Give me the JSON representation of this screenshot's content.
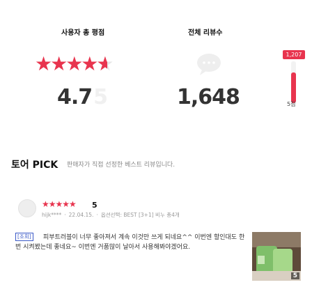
{
  "summary": {
    "rating_title": "사용자 총 평점",
    "reviews_title": "전체 리뷰수",
    "rating_value": "4.7",
    "rating_max": "5",
    "review_count": "1,648",
    "stars_filled": 4.7,
    "bar": {
      "badge": "1,207",
      "label": "5점",
      "fill_fraction": 0.73
    }
  },
  "pick": {
    "title": "토어 PICK",
    "subtitle": "판매자가 직접 선정한 베스트 리뷰입니다."
  },
  "review": {
    "stars": "★★★★★",
    "score": "5",
    "user": "hijk****",
    "date": "22.04.15.",
    "option": "옵션선택: BEST [3+1] 비누 총4개",
    "tag": "[조회]",
    "text": "피부트러블이 너무 좋아져서 계속 이것만 쓰게 되네요^^ 이번엔 할인대도 한번 시켜봤는데 좋네요~ 이번엔 거품많이 날아서 사용해봐야겠어요.",
    "photo_count": "5"
  },
  "colors": {
    "accent": "#e8344e",
    "tag_blue": "#3a59c7"
  }
}
